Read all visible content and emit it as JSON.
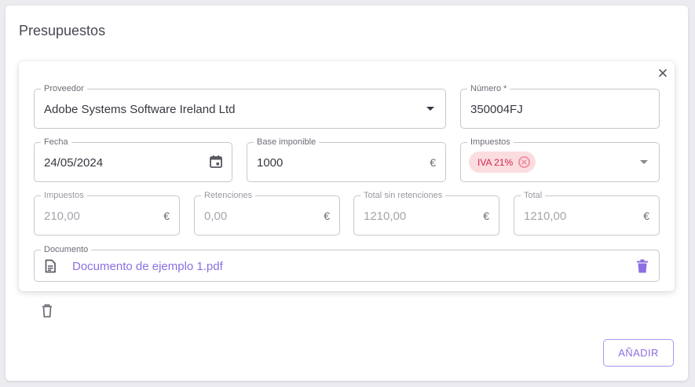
{
  "page": {
    "title": "Presupuestos"
  },
  "form": {
    "proveedor": {
      "label": "Proveedor",
      "value": "Adobe Systems Software Ireland Ltd"
    },
    "numero": {
      "label": "Número *",
      "value": "350004FJ"
    },
    "fecha": {
      "label": "Fecha",
      "value": "24/05/2024"
    },
    "base_imponible": {
      "label": "Base imponible",
      "value": "1000",
      "suffix": "€"
    },
    "impuestos_select": {
      "label": "Impuestos",
      "chip": "IVA 21%"
    },
    "impuestos": {
      "label": "Impuestos",
      "value": "210,00",
      "suffix": "€"
    },
    "retenciones": {
      "label": "Retenciones",
      "value": "0,00",
      "suffix": "€"
    },
    "total_sin_retenciones": {
      "label": "Total sin retenciones",
      "value": "1210,00",
      "suffix": "€"
    },
    "total": {
      "label": "Total",
      "value": "1210,00",
      "suffix": "€"
    },
    "documento": {
      "label": "Documento",
      "filename": "Documento de ejemplo 1.pdf"
    }
  },
  "actions": {
    "add_label": "AÑADIR"
  },
  "icons": {
    "close": "close-icon",
    "calendar": "calendar-icon",
    "document": "document-icon",
    "trash": "trash-icon",
    "trash_outline": "trash-outline-icon"
  },
  "colors": {
    "accent": "#8c6fe0",
    "chip_bg": "#fbdde0",
    "chip_text": "#d2264a"
  }
}
